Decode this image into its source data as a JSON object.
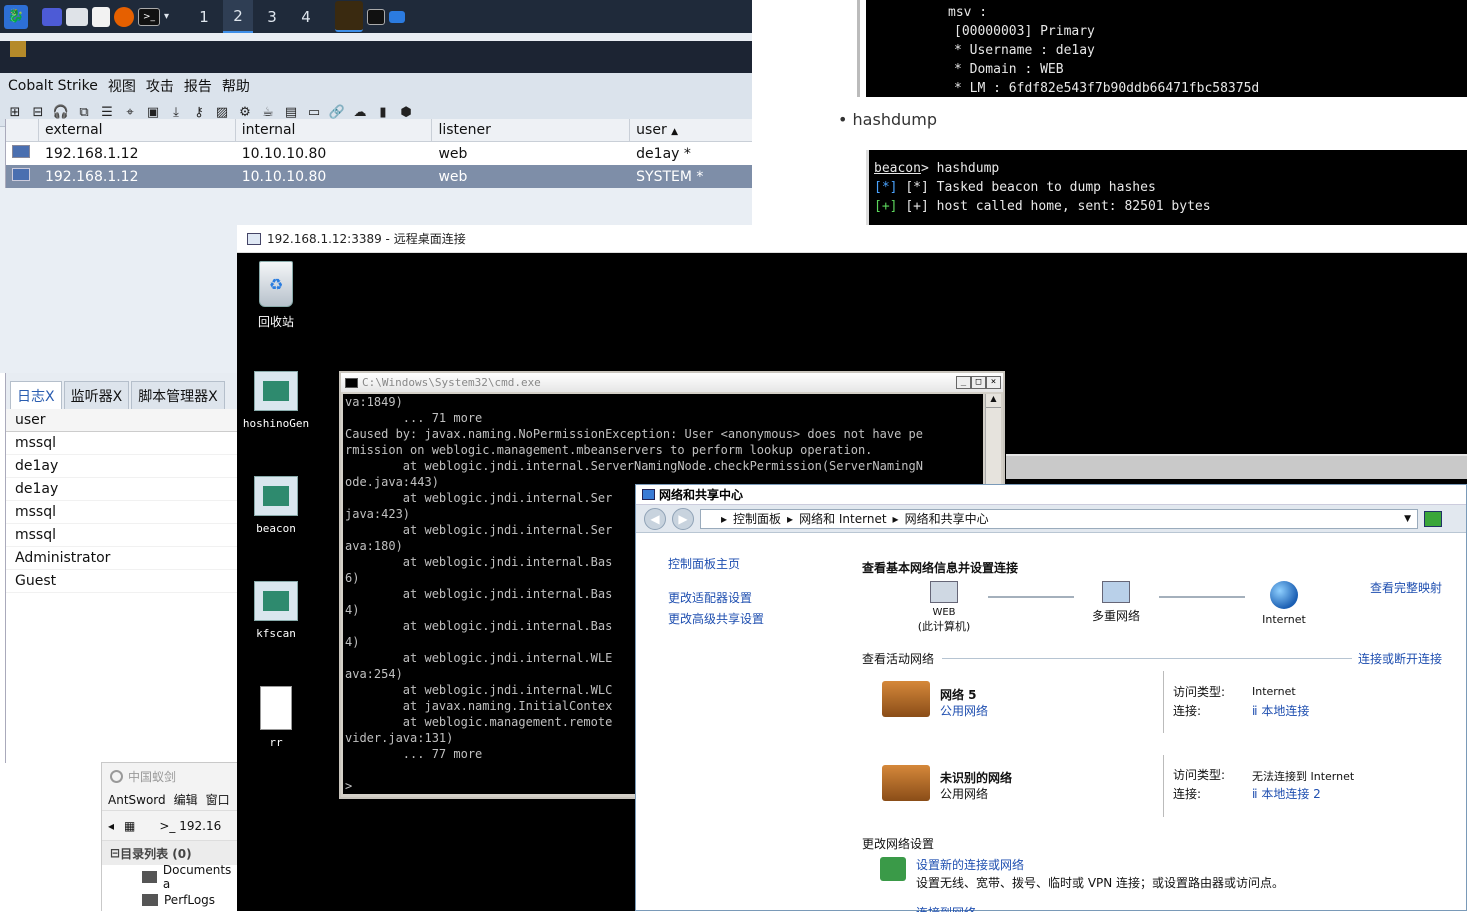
{
  "taskbar": {
    "workspaces": [
      "1",
      "2",
      "3",
      "4"
    ],
    "active_workspace": "2"
  },
  "cobalt": {
    "menu": [
      "Cobalt Strike",
      "视图",
      "攻击",
      "报告",
      "帮助"
    ],
    "columns": [
      "external",
      "internal",
      "listener",
      "user"
    ],
    "sort_indicator": "▲",
    "rows": [
      {
        "external": "192.168.1.12",
        "internal": "10.10.10.80",
        "listener": "web",
        "user": "de1ay *"
      },
      {
        "external": "192.168.1.12",
        "internal": "10.10.10.80",
        "listener": "web",
        "user": "SYSTEM *"
      }
    ],
    "tabs": [
      "日志X",
      "监听器X",
      "脚本管理器X"
    ],
    "user_header": "user",
    "users": [
      "mssql",
      "de1ay",
      "de1ay",
      "mssql",
      "mssql",
      "Administrator",
      "Guest"
    ]
  },
  "blog": {
    "term1_lines": [
      "msv :",
      "[00000003] Primary",
      "* Username : de1ay",
      "* Domain   : WEB",
      "* LM     : 6fdf82e543f7b90ddb66471fbc58375d"
    ],
    "bullet": "hashdump",
    "term2_prompt": "beacon",
    "term2_cmd": "> hashdump",
    "term2_lines": [
      "[*] Tasked beacon to dump hashes",
      "[+] host called home, sent: 82501 bytes"
    ]
  },
  "antsword": {
    "title": "中国蚁剑",
    "menu": [
      "AntSword",
      "编辑",
      "窗口"
    ],
    "tab": ">_ 192.16",
    "dir_header": "目录列表 (0)",
    "folders": [
      "Documents a",
      "PerfLogs"
    ]
  },
  "rdp": {
    "title": "192.168.1.12:3389 - 远程桌面连接",
    "icons": [
      "回收站",
      "hoshinoGen",
      "beacon",
      "kfscan",
      "rr"
    ]
  },
  "cmd": {
    "title": "C:\\Windows\\System32\\cmd.exe",
    "text": "va:1849)\n        ... 71 more\nCaused by: javax.naming.NoPermissionException: User <anonymous> does not have pe\nrmission on weblogic.management.mbeanservers to perform lookup operation.\n        at weblogic.jndi.internal.ServerNamingNode.checkPermission(ServerNamingN\node.java:443)\n        at weblogic.jndi.internal.Ser\njava:423)\n        at weblogic.jndi.internal.Ser\nava:180)\n        at weblogic.jndi.internal.Bas\n6)\n        at weblogic.jndi.internal.Bas\n4)\n        at weblogic.jndi.internal.Bas\n4)\n        at weblogic.jndi.internal.WLE\nava:254)\n        at weblogic.jndi.internal.WLC\n        at javax.naming.InitialContex\n        at weblogic.management.remote\nvider.java:131)\n        ... 77 more\n\n>"
  },
  "network": {
    "title": "网络和共享中心",
    "breadcrumb": [
      "控制面板",
      "网络和 Internet",
      "网络和共享中心"
    ],
    "left_links": [
      "控制面板主页",
      "更改适配器设置",
      "更改高级共享设置"
    ],
    "heading": "查看基本网络信息并设置连接",
    "full_map": "查看完整映射",
    "nodes": [
      {
        "label": "WEB",
        "sub": "(此计算机)"
      },
      {
        "label": "多重网络",
        "sub": ""
      },
      {
        "label": "Internet",
        "sub": ""
      }
    ],
    "active_label": "查看活动网络",
    "connect_link": "连接或断开连接",
    "networks": [
      {
        "name": "网络  5",
        "type": "公用网络",
        "access_label": "访问类型:",
        "access": "Internet",
        "conn_label": "连接:",
        "conn": "本地连接"
      },
      {
        "name": "未识别的网络",
        "type": "公用网络",
        "access_label": "访问类型:",
        "access": "无法连接到 Internet",
        "conn_label": "连接:",
        "conn": "本地连接 2"
      }
    ],
    "change_label": "更改网络设置",
    "setup_link": "设置新的连接或网络",
    "setup_desc": "设置无线、宽带、拨号、临时或 VPN 连接；或设置路由器或访问点。",
    "next_link": "连接到网络"
  }
}
